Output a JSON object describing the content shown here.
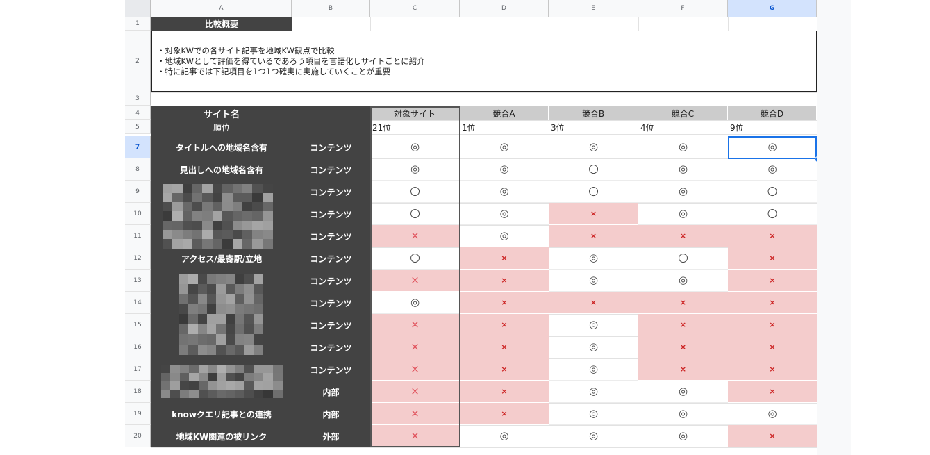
{
  "columns": [
    "A",
    "B",
    "C",
    "D",
    "E",
    "F",
    "G"
  ],
  "active_column": "G",
  "rows": [
    "1",
    "2",
    "3",
    "4",
    "5",
    "7",
    "8",
    "9",
    "10",
    "11",
    "12",
    "13",
    "14",
    "15",
    "16",
    "17",
    "18",
    "19",
    "20"
  ],
  "active_row": "7",
  "section_title": "比較概要",
  "summary_lines": [
    "・対象KWでの各サイト記事を地域KW観点で比較",
    "・地域KWとして評価を得ているであろう項目を言語化しサイトごとに紹介",
    "・特に記事では下記項目を1つ1つ確実に実施していくことが重要"
  ],
  "header": {
    "site_label": "サイト名",
    "rank_label": "順位",
    "sites": [
      "対象サイト",
      "競合A",
      "競合B",
      "競合C",
      "競合D"
    ],
    "ranks": [
      "21位",
      "1位",
      "3位",
      "4位",
      "9位"
    ]
  },
  "items": [
    {
      "label": "タイトルへの地域名含有",
      "type": "コンテンツ",
      "marks": [
        "◎",
        "◎",
        "◎",
        "◎",
        "◎"
      ]
    },
    {
      "label": "見出しへの地域名含有",
      "type": "コンテンツ",
      "marks": [
        "◎",
        "◎",
        "○",
        "◎",
        "◎"
      ]
    },
    {
      "label": "",
      "type": "コンテンツ",
      "marks": [
        "○",
        "◎",
        "○",
        "◎",
        "○"
      ]
    },
    {
      "label": "",
      "type": "コンテンツ",
      "marks": [
        "○",
        "◎",
        "×",
        "◎",
        "○"
      ]
    },
    {
      "label": "",
      "type": "コンテンツ",
      "marks": [
        "×",
        "◎",
        "×",
        "×",
        "×"
      ]
    },
    {
      "label": "アクセス/最寄駅/立地",
      "type": "コンテンツ",
      "marks": [
        "○",
        "×",
        "◎",
        "○",
        "×"
      ]
    },
    {
      "label": "",
      "type": "コンテンツ",
      "marks": [
        "×",
        "×",
        "◎",
        "◎",
        "×"
      ]
    },
    {
      "label": "",
      "type": "コンテンツ",
      "marks": [
        "◎",
        "×",
        "×",
        "×",
        "×"
      ]
    },
    {
      "label": "",
      "type": "コンテンツ",
      "marks": [
        "×",
        "×",
        "◎",
        "×",
        "×"
      ]
    },
    {
      "label": "",
      "type": "コンテンツ",
      "marks": [
        "×",
        "×",
        "◎",
        "×",
        "×"
      ]
    },
    {
      "label": "",
      "type": "コンテンツ",
      "marks": [
        "×",
        "×",
        "◎",
        "×",
        "×"
      ]
    },
    {
      "label": "",
      "type": "内部",
      "marks": [
        "×",
        "×",
        "◎",
        "◎",
        "×"
      ]
    },
    {
      "label": "knowクエリ記事との連携",
      "type": "内部",
      "marks": [
        "×",
        "×",
        "◎",
        "◎",
        "◎"
      ]
    },
    {
      "label": "地域KW関連の被リンク",
      "type": "外部",
      "marks": [
        "×",
        "◎",
        "◎",
        "◎",
        "×"
      ]
    }
  ],
  "colors": {
    "dark": "#434343",
    "pink": "#f4cccc",
    "header_grey": "#cccccc",
    "selection": "#1a73e8",
    "cross": "#e0505a"
  }
}
